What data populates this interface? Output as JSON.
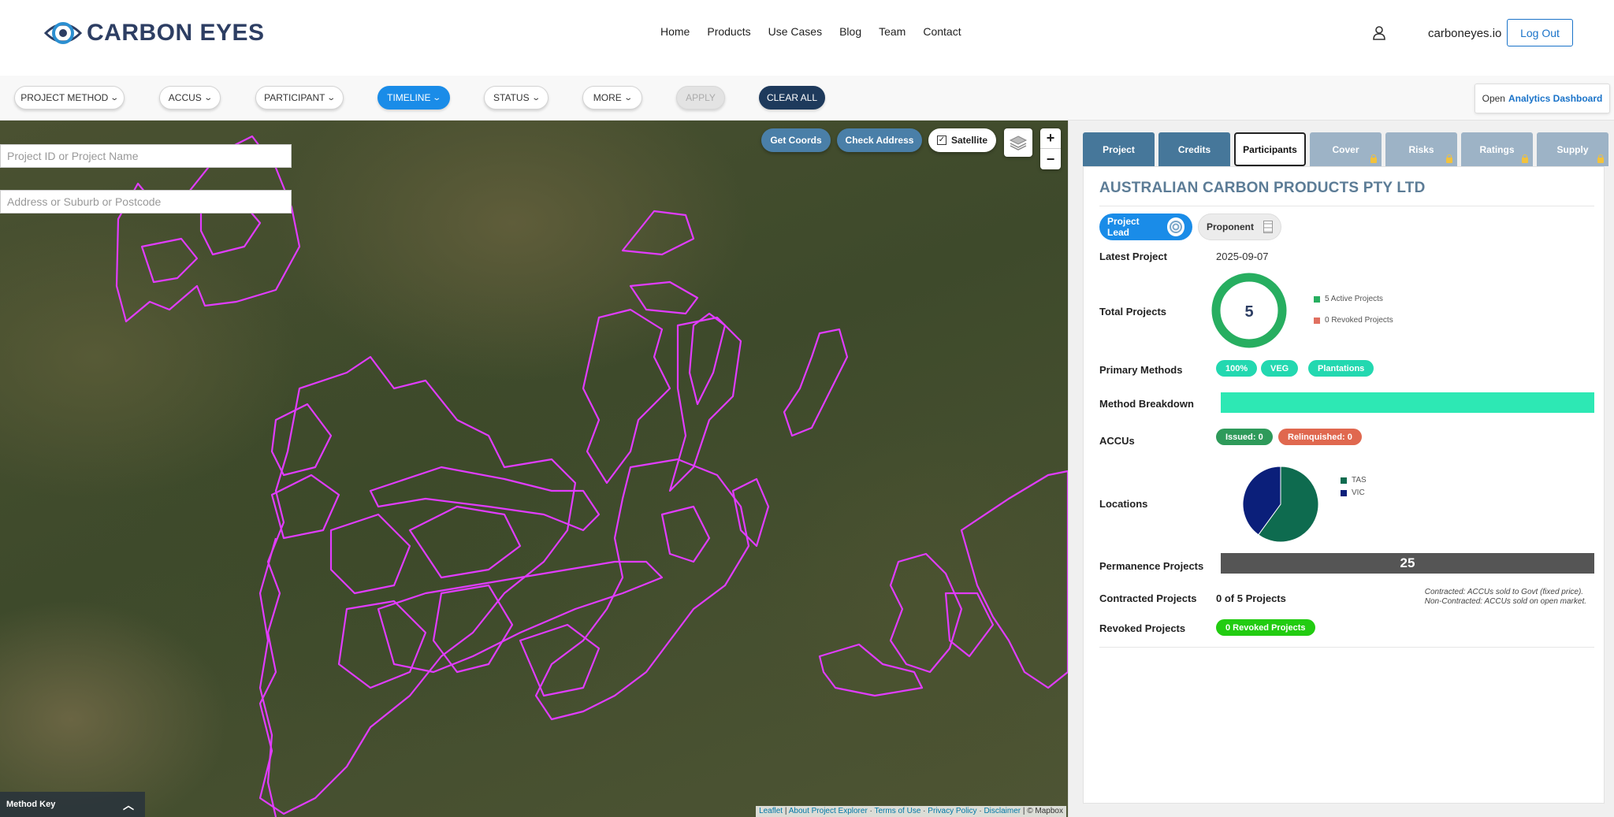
{
  "header": {
    "logo_text": "CARBON EYES",
    "nav": [
      "Home",
      "Products",
      "Use Cases",
      "Blog",
      "Team",
      "Contact"
    ],
    "site": "carboneyes.io",
    "logout": "Log Out"
  },
  "filters": {
    "project_method": "PROJECT METHOD",
    "accus": "ACCUS",
    "participant": "PARTICIPANT",
    "timeline": "TIMELINE",
    "status": "STATUS",
    "more": "MORE",
    "apply": "APPLY",
    "clear_all": "CLEAR ALL",
    "analytics_prefix": "Open",
    "analytics_link": "Analytics Dashboard"
  },
  "map": {
    "project_search_placeholder": "Project ID or Project Name",
    "address_search_placeholder": "Address or Suburb or Postcode",
    "get_coords": "Get Coords",
    "check_address": "Check Address",
    "satellite": "Satellite",
    "satellite_checked": true,
    "zoom_in": "+",
    "zoom_out": "−",
    "method_key": "Method Key",
    "attribution": {
      "leaflet": "Leaflet",
      "sep": "|",
      "about": "About Project Explorer",
      "terms": "Terms of Use",
      "privacy": "Privacy Policy",
      "disclaimer": "Disclaimer",
      "mapbox": "| © Mapbox"
    },
    "polygon_color": "#e13cff"
  },
  "panel": {
    "tabs": [
      {
        "label": "Project",
        "state": "dark",
        "locked": false
      },
      {
        "label": "Credits",
        "state": "dark",
        "locked": false
      },
      {
        "label": "Participants",
        "state": "sel",
        "locked": false
      },
      {
        "label": "Cover",
        "state": "muted",
        "locked": true
      },
      {
        "label": "Risks",
        "state": "muted",
        "locked": true
      },
      {
        "label": "Ratings",
        "state": "muted",
        "locked": true
      },
      {
        "label": "Supply",
        "state": "muted",
        "locked": true
      }
    ],
    "org_name": "AUSTRALIAN CARBON PRODUCTS PTY LTD",
    "role_lead": "Project Lead",
    "role_proponent": "Proponent",
    "latest_project_label": "Latest Project",
    "latest_project_value": "2025-09-07",
    "total_projects_label": "Total Projects",
    "total_projects_value": "5",
    "active_projects_legend": "5 Active Projects",
    "revoked_projects_legend": "0 Revoked Projects",
    "active_projects": 5,
    "revoked_projects": 0,
    "primary_methods_label": "Primary Methods",
    "primary_methods": [
      "100%",
      "VEG",
      "Plantations"
    ],
    "method_breakdown_label": "Method Breakdown",
    "method_breakdown_fraction": 1.0,
    "accus_label": "ACCUs",
    "issued": "Issued: 0",
    "relinquished": "Relinquished: 0",
    "locations_label": "Locations",
    "locations": [
      {
        "name": "TAS",
        "fraction": 0.6,
        "color": "#0e6b4f"
      },
      {
        "name": "VIC",
        "fraction": 0.4,
        "color": "#0b1f7a"
      }
    ],
    "permanence_label": "Permanence Projects",
    "permanence_value": "25",
    "contracted_label": "Contracted Projects",
    "contracted_value": "0 of 5 Projects",
    "contracted_note_1": "Contracted: ACCUs sold to Govt (fixed price).",
    "contracted_note_2": "Non-Contracted: ACCUs sold on open market.",
    "revoked_label": "Revoked Projects",
    "revoked_value": "0 Revoked Projects",
    "colors": {
      "green_ring": "#27ae60",
      "revoked_red": "#e07060",
      "teal": "#23d8b0",
      "method_bar": "#2de8b4",
      "issued_green": "#2e9a5a",
      "relinquished_orange": "#e0684f",
      "revoked_bright": "#22cc11",
      "permanence_bar": "#555555"
    }
  }
}
